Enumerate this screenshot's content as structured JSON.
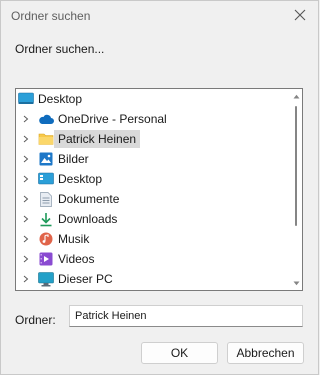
{
  "window": {
    "title": "Ordner suchen",
    "prompt": "Ordner suchen..."
  },
  "tree": {
    "root": {
      "label": "Desktop",
      "icon": "desktop-icon"
    },
    "items": [
      {
        "label": "OneDrive - Personal",
        "icon": "cloud-icon",
        "expandable": true,
        "selected": false
      },
      {
        "label": "Patrick Heinen",
        "icon": "folder-icon",
        "expandable": true,
        "selected": true
      },
      {
        "label": "Bilder",
        "icon": "pictures-icon",
        "expandable": true,
        "selected": false
      },
      {
        "label": "Desktop",
        "icon": "desktop-icon",
        "expandable": true,
        "selected": false
      },
      {
        "label": "Dokumente",
        "icon": "documents-icon",
        "expandable": true,
        "selected": false
      },
      {
        "label": "Downloads",
        "icon": "download-icon",
        "expandable": true,
        "selected": false
      },
      {
        "label": "Musik",
        "icon": "music-icon",
        "expandable": true,
        "selected": false
      },
      {
        "label": "Videos",
        "icon": "videos-icon",
        "expandable": true,
        "selected": false
      },
      {
        "label": "Dieser PC",
        "icon": "computer-icon",
        "expandable": true,
        "selected": false
      }
    ]
  },
  "folder_field": {
    "label": "Ordner:",
    "value": "Patrick Heinen"
  },
  "buttons": {
    "ok": "OK",
    "cancel": "Abbrechen"
  },
  "colors": {
    "selection": "#d9d9d9",
    "onedrive": "#0f6cbd",
    "folder": "#f8c94a"
  }
}
